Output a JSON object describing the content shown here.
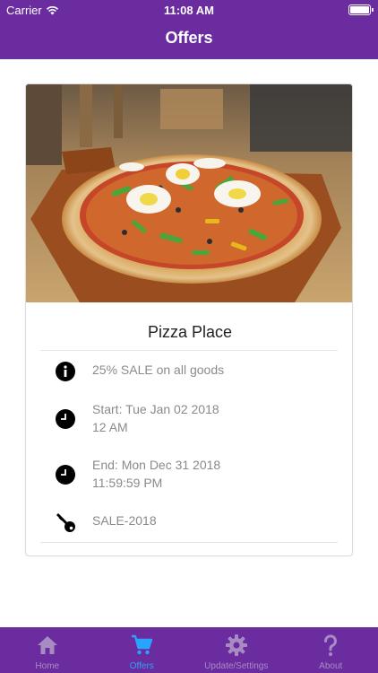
{
  "status_bar": {
    "carrier": "Carrier",
    "time": "11:08 AM"
  },
  "nav": {
    "title": "Offers"
  },
  "offer": {
    "title": "Pizza Place",
    "description": "25% SALE on all goods",
    "start_line1": "Start: Tue Jan 02 2018",
    "start_line2": "12 AM",
    "end_line1": "End: Mon Dec 31 2018",
    "end_line2": "11:59:59 PM",
    "code": "SALE-2018"
  },
  "tabs": [
    {
      "label": "Home",
      "icon": "home-icon",
      "active": false
    },
    {
      "label": "Offers",
      "icon": "cart-icon",
      "active": true
    },
    {
      "label": "Update/Settings",
      "icon": "gear-icon",
      "active": false
    },
    {
      "label": "About",
      "icon": "question-icon",
      "active": false
    }
  ],
  "colors": {
    "brand": "#6a2c9f",
    "tab_active": "#2aa3ff",
    "tab_inactive": "#a98bc4",
    "secondary_text": "#8a8a8a"
  }
}
